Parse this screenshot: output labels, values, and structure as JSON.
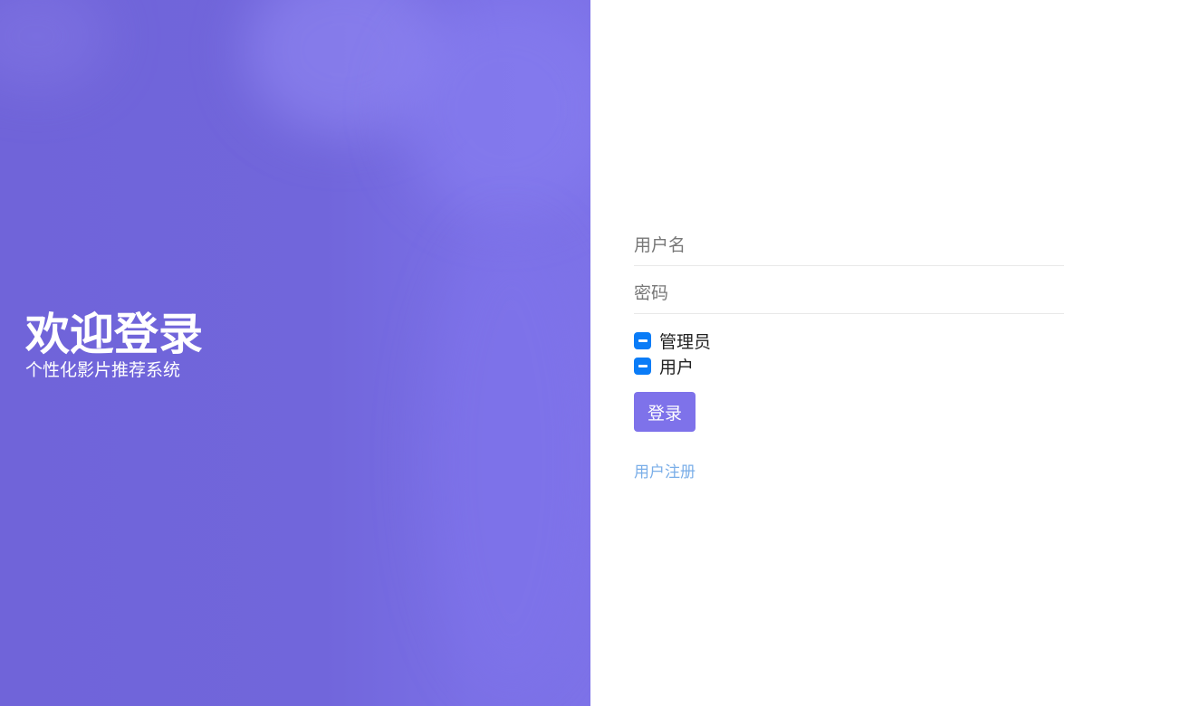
{
  "hero": {
    "title": "欢迎登录",
    "subtitle": "个性化影片推荐系统"
  },
  "form": {
    "username_placeholder": "用户名",
    "password_placeholder": "密码",
    "roles": [
      {
        "label": "管理员",
        "state": "indeterminate"
      },
      {
        "label": "用户",
        "state": "indeterminate"
      }
    ],
    "login_label": "登录",
    "register_label": "用户注册"
  },
  "colors": {
    "hero_bg": "#7166db",
    "button_bg": "#7e72ea",
    "checkbox": "#0a7cf7",
    "link": "#7aaee8"
  }
}
